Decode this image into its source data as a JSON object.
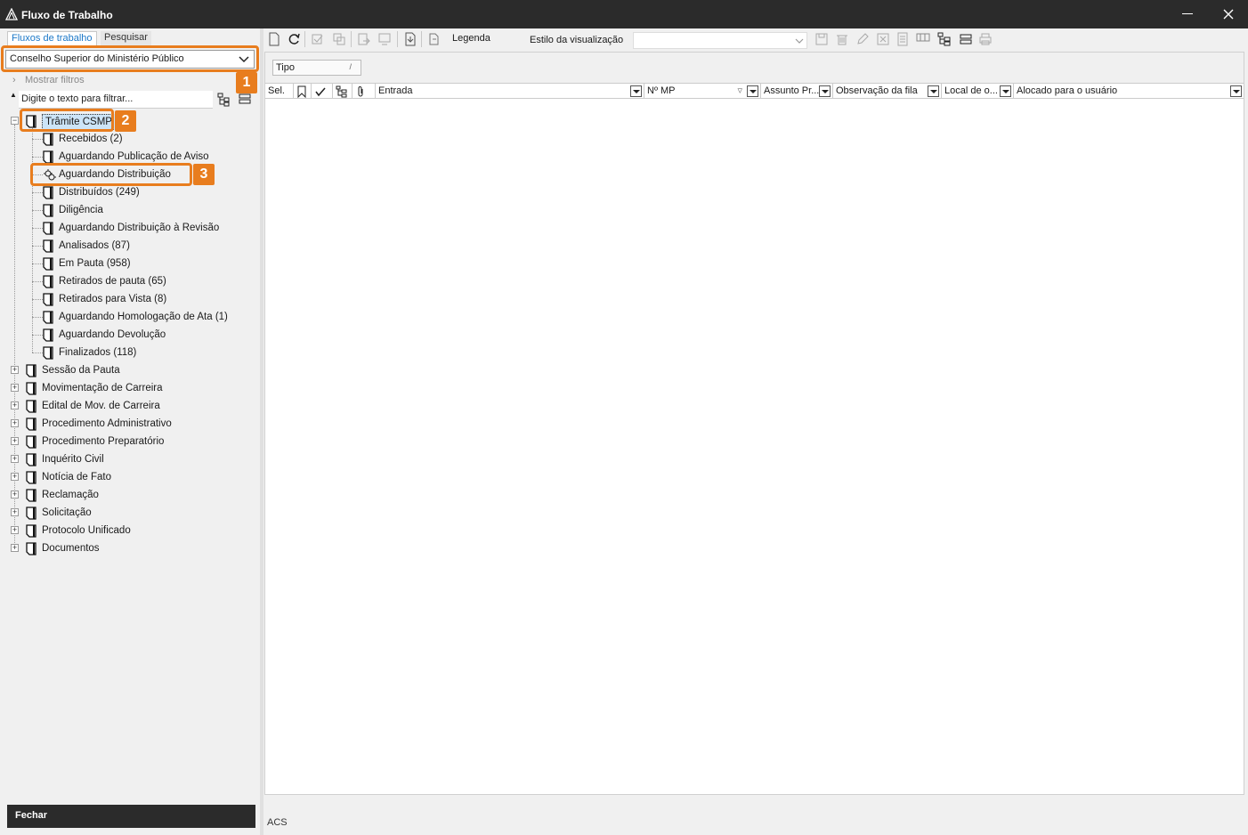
{
  "window": {
    "title": "Fluxo de Trabalho"
  },
  "left_panel": {
    "tabs": [
      "Fluxos de trabalho",
      "Pesquisar"
    ],
    "queue_selector": "Conselho Superior do Ministério Público",
    "show_filters": "Mostrar filtros",
    "filter_placeholder": "Digite o texto para filtrar...",
    "tree": {
      "expanded": {
        "label": "Trâmite CSMP",
        "children": [
          "Recebidos (2)",
          "Aguardando Publicação de Aviso",
          "Aguardando Distribuição",
          "Distribuídos (249)",
          "Diligência",
          "Aguardando Distribuição à Revisão",
          "Analisados (87)",
          "Em Pauta (958)",
          "Retirados de pauta (65)",
          "Retirados para Vista (8)",
          "Aguardando Homologação de Ata (1)",
          "Aguardando Devolução",
          "Finalizados (118)"
        ]
      },
      "collapsed": [
        "Sessão da Pauta",
        "Movimentação de Carreira",
        "Edital de Mov. de Carreira",
        "Procedimento Administrativo",
        "Procedimento Preparatório",
        "Inquérito Civil",
        "Notícia de Fato",
        "Reclamação",
        "Solicitação",
        "Protocolo Unificado",
        "Documentos"
      ]
    },
    "close_button": "Fechar"
  },
  "callouts": [
    "1",
    "2",
    "3"
  ],
  "toolbar": {
    "legend_label": "Legenda",
    "view_style_label": "Estilo da visualização",
    "view_style_value": ""
  },
  "grid": {
    "group_by": "Tipo",
    "columns": [
      "Sel.",
      "Entrada",
      "Nº MP",
      "Assunto Pr...",
      "Observação da fila",
      "Local de o...",
      "Alocado para o usuário"
    ]
  },
  "status_bar": {
    "user": "ACS"
  },
  "colors": {
    "accent": "#e87d1e",
    "titlebar": "#2b2b2b",
    "link": "#1c78c8"
  }
}
